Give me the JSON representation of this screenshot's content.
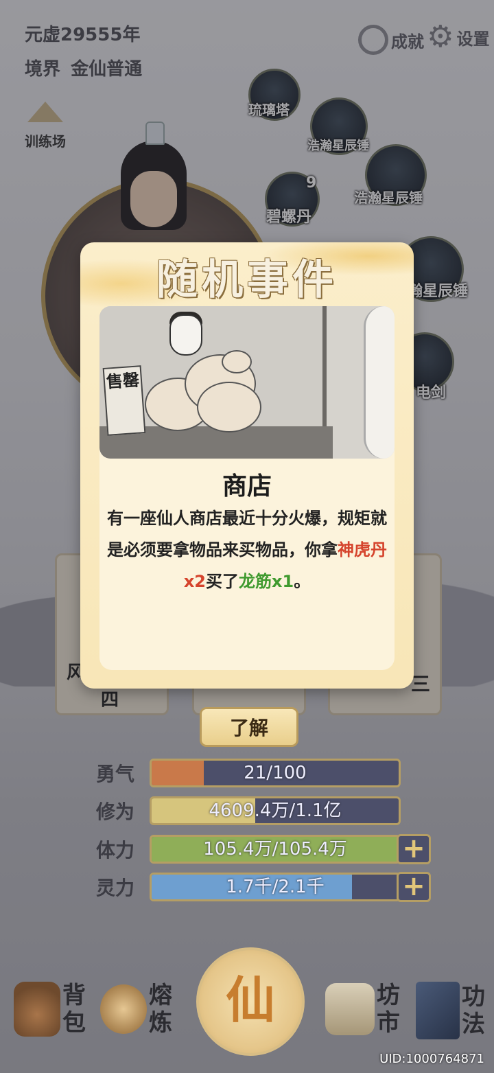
{
  "header": {
    "year": "元虚29555年",
    "realm_label": "境界",
    "realm_value": "金仙普通",
    "achievement_label": "成就",
    "settings_label": "设置"
  },
  "map": {
    "training_ground": "训练场",
    "liuli_tower": "琉璃塔",
    "hammer_1": "浩瀚星辰锤",
    "hammer_2": "浩瀚星辰锤",
    "pill": "碧螺丹",
    "pill_count": "9",
    "hammer_3_partial": "瀚星辰锤",
    "sword_partial": "电剑"
  },
  "cards_behind": {
    "left_char": "风",
    "left_sub": "四",
    "right_char": "三"
  },
  "modal": {
    "title": "随机事件",
    "sign_text": "售罄",
    "event_name": "商店",
    "desc_1": "有一座仙人商店最近十分火爆，规矩就是必须要拿物品来买物品，你拿",
    "item_given": "神虎丹x2",
    "desc_2": "买了",
    "item_got": "龙筋x1",
    "desc_3": "。",
    "confirm_button": "了解"
  },
  "stats": [
    {
      "label": "勇气",
      "text": "21/100",
      "fill": 0.21,
      "color": "#c9794a"
    },
    {
      "label": "修为",
      "text": "4609.4万/1.1亿",
      "fill": 0.42,
      "color": "#d6c57d"
    },
    {
      "label": "体力",
      "text": "105.4万/105.4万",
      "fill": 1.0,
      "color": "#8fae58"
    },
    {
      "label": "灵力",
      "text": "1.7千/2.1千",
      "fill": 0.81,
      "color": "#6e9fd0"
    }
  ],
  "nav": {
    "bag": "背包",
    "refine": "熔炼",
    "center": "仙",
    "market": "坊市",
    "skills": "功法"
  },
  "uid": "UID:1000764871"
}
